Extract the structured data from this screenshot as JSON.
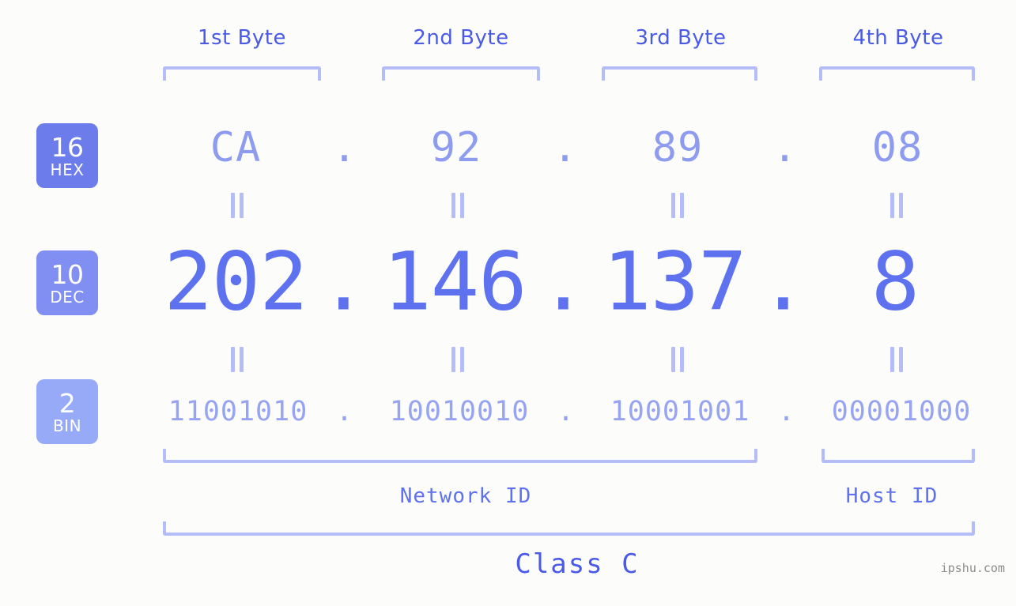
{
  "page": {
    "background_color": "#fcfdfa",
    "watermark": "ipshu.com"
  },
  "colors": {
    "accent_strong": "#4a5ae8",
    "accent_dec": "#5e71ee",
    "accent_hex": "#8e9cf0",
    "accent_bin": "#97a4f2",
    "bracket": "#b4bdf7",
    "badge_hex": "#6d7ceb",
    "badge_dec": "#808ff1",
    "badge_bin": "#97aaf7"
  },
  "byte_headers": [
    {
      "label": "1st Byte"
    },
    {
      "label": "2nd Byte"
    },
    {
      "label": "3rd Byte"
    },
    {
      "label": "4th Byte"
    }
  ],
  "rows": [
    {
      "badge_num": "16",
      "badge_sub": "HEX",
      "badge_color": "#6d7ceb",
      "values": [
        "CA",
        "92",
        "89",
        "08"
      ],
      "separator": "."
    },
    {
      "badge_num": "10",
      "badge_sub": "DEC",
      "badge_color": "#808ff1",
      "values": [
        "202",
        "146",
        "137",
        "8"
      ],
      "separator": "."
    },
    {
      "badge_num": "2",
      "badge_sub": "BIN",
      "badge_color": "#97aaf7",
      "values": [
        "11001010",
        "10010010",
        "10001001",
        "00001000"
      ],
      "separator": "."
    }
  ],
  "equality_marks": {
    "glyph": "||",
    "count_per_row": 4,
    "rows": 2
  },
  "segments": {
    "network_id": "Network ID",
    "host_id": "Host ID",
    "class": "Class C"
  }
}
